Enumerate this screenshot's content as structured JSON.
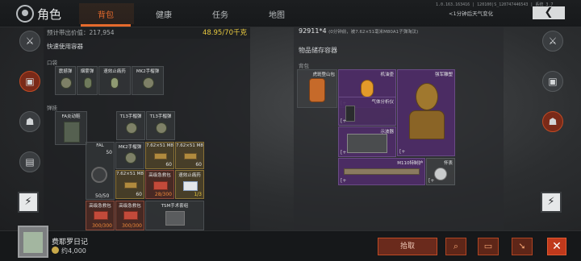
{
  "header": {
    "title": "角色",
    "tabs": [
      "背包",
      "健康",
      "任务",
      "地图"
    ],
    "active_tab": "背包",
    "sysinfo": "1.0.163.163416 | 120100|S_120747446543 | 系统 3.7",
    "weather": "<1分钟后天气变化",
    "back_label": "❮"
  },
  "left": {
    "carry_label": "预计带出价值：",
    "carry_value": "217,954",
    "weight": "48.95/70千克",
    "quick_title": "快速使用容器",
    "pocket_label": "口袋",
    "sling_label": "弹挂",
    "pockets": [
      {
        "name": "震撼弹"
      },
      {
        "name": "烟雾弹"
      },
      {
        "name": "速效止痛药"
      },
      {
        "name": "MK2手榴弹"
      }
    ],
    "vest": {
      "name": "FA炎动鞋"
    },
    "grid": [
      {
        "name": "T13手榴弹",
        "count": ""
      },
      {
        "name": "T13手榴弹",
        "count": ""
      },
      {
        "name": "FAL",
        "count": "50"
      },
      {
        "name": "MK2手榴弹",
        "count": ""
      },
      {
        "name": "7.62×51 M80A1",
        "count": "60"
      },
      {
        "name": "7.62×51 M80A1",
        "count": "60"
      },
      {
        "name": "FAL弹匣",
        "count": "50/50"
      },
      {
        "name": "7.62×51 M80A1",
        "count": "60"
      },
      {
        "name": "高级急救包",
        "count": "28/300"
      },
      {
        "name": "速效止痛药",
        "count": "1/3"
      },
      {
        "name": "高级急救包",
        "count": "300/300"
      },
      {
        "name": "高级急救包",
        "count": "300/300"
      },
      {
        "name": "TSM手术套组",
        "count": ""
      }
    ]
  },
  "right": {
    "value_line": "92911*4",
    "value_note": "(0分钟前，被7.62×51毫米M80A1子弹淘汰)",
    "storage_title": "物品储存容器",
    "bag_label": "背包",
    "items": [
      {
        "name": "虎斑登山包"
      },
      {
        "name": "机油壶"
      },
      {
        "name": "强军雕塑"
      },
      {
        "name": "气体分析仪"
      },
      {
        "name": "示波器"
      },
      {
        "name": "M110特制护"
      },
      {
        "name": "怀表"
      }
    ]
  },
  "bottom": {
    "item_name": "费耶罗日记",
    "item_price": "约4,000",
    "pickup_label": "拾取"
  },
  "colors": {
    "accent": "#e66a2c",
    "weight": "#e8c93f",
    "purple_rarity": "#4b2c63",
    "gold_rarity": "#76602c"
  }
}
